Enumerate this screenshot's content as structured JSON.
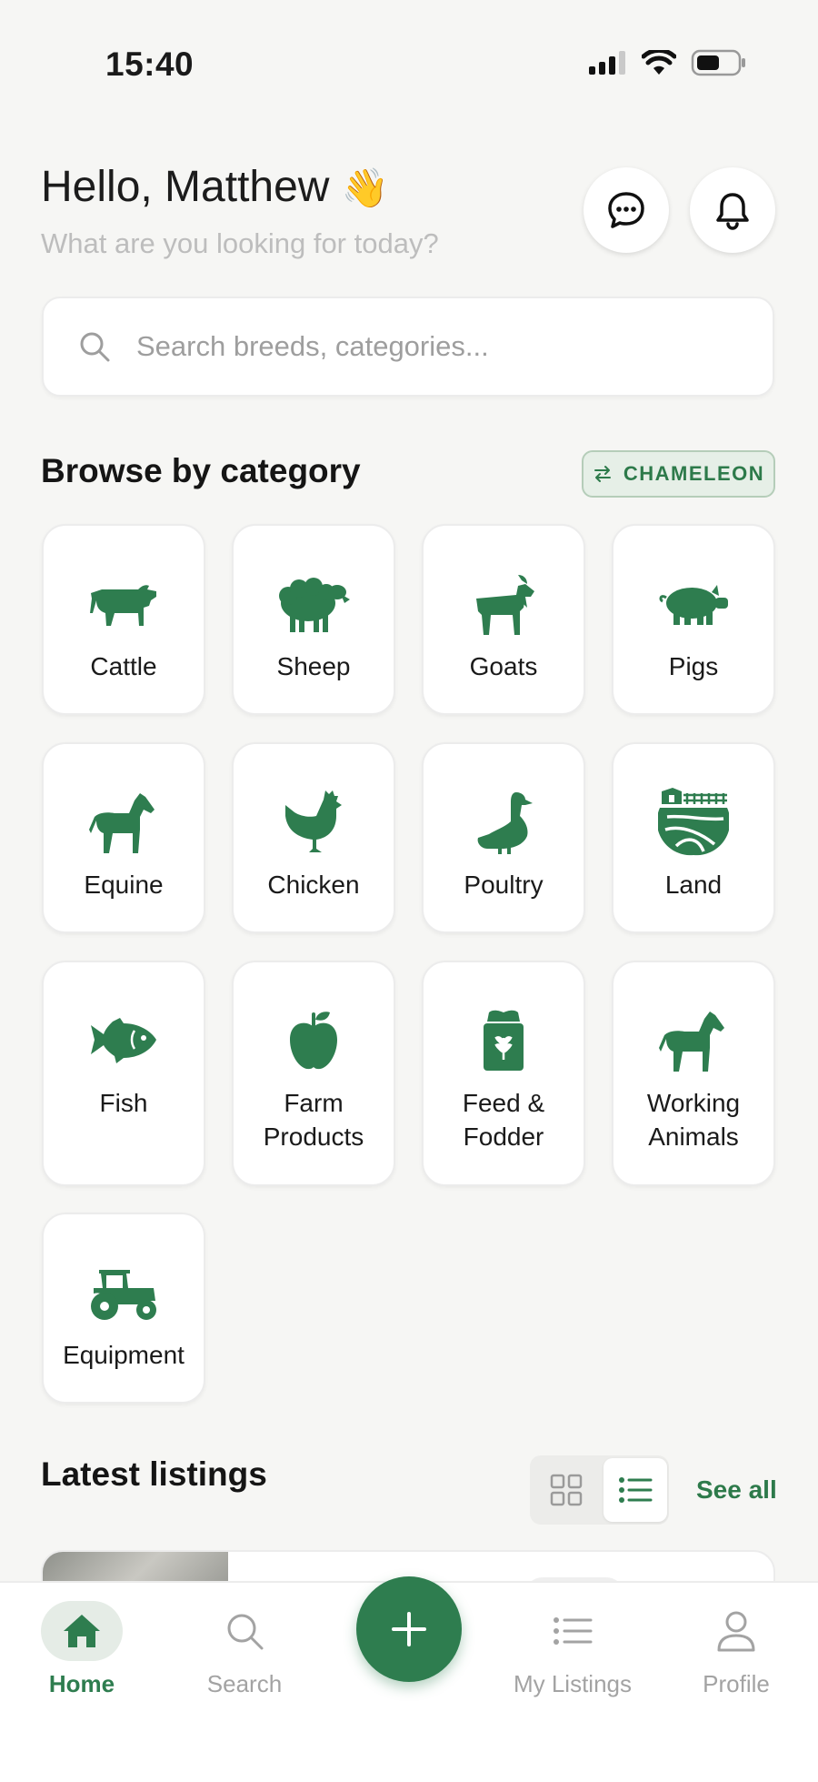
{
  "status_bar": {
    "time": "15:40"
  },
  "header": {
    "greeting": "Hello, Matthew",
    "wave_emoji": "👋",
    "subtitle": "What are you looking for today?",
    "messages_icon": "chat-bubble-icon",
    "notifications_icon": "bell-icon"
  },
  "search": {
    "placeholder": "Search breeds, categories..."
  },
  "categories_section": {
    "title": "Browse by category",
    "theme_toggle_label": "CHAMELEON",
    "items": [
      {
        "label": "Cattle",
        "icon": "cow-icon"
      },
      {
        "label": "Sheep",
        "icon": "sheep-icon"
      },
      {
        "label": "Goats",
        "icon": "goat-icon"
      },
      {
        "label": "Pigs",
        "icon": "pig-icon"
      },
      {
        "label": "Equine",
        "icon": "horse-icon"
      },
      {
        "label": "Chicken",
        "icon": "chicken-icon"
      },
      {
        "label": "Poultry",
        "icon": "goose-icon"
      },
      {
        "label": "Land",
        "icon": "farmland-icon"
      },
      {
        "label": "Fish",
        "icon": "fish-icon"
      },
      {
        "label": "Farm\nProducts",
        "icon": "apple-icon"
      },
      {
        "label": "Feed &\nFodder",
        "icon": "feed-bag-icon"
      },
      {
        "label": "Working\nAnimals",
        "icon": "horse-icon"
      },
      {
        "label": "Equipment",
        "icon": "tractor-icon"
      }
    ]
  },
  "latest_section": {
    "title": "Latest listings",
    "see_all": "See all",
    "view_mode": "list"
  },
  "bottom_nav": {
    "items": [
      {
        "label": "Home",
        "icon": "home-icon",
        "active": true
      },
      {
        "label": "Search",
        "icon": "search-icon",
        "active": false
      },
      {
        "label": "My Listings",
        "icon": "list-icon",
        "active": false
      },
      {
        "label": "Profile",
        "icon": "person-icon",
        "active": false
      }
    ],
    "fab_icon": "plus-icon"
  },
  "colors": {
    "accent": "#2e7d4f",
    "background": "#f6f6f4",
    "muted_text": "#a3a3a3"
  }
}
